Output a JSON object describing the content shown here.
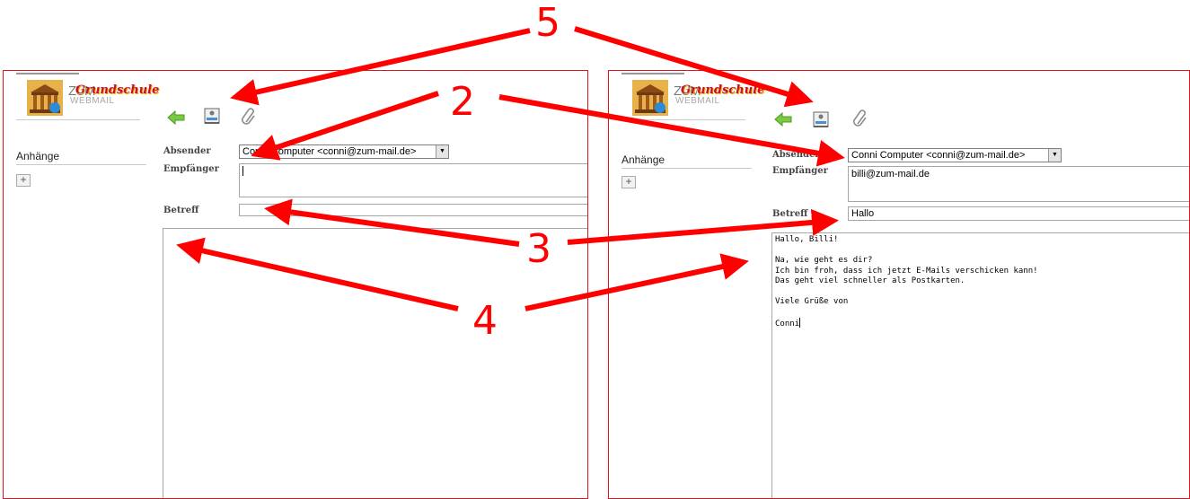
{
  "logo": {
    "zum": "ZUM",
    "grundschule": "Grundschule",
    "webmail": "WEBMAIL"
  },
  "icons": {
    "back": "arrow-left-icon",
    "addressbook": "address-book-icon",
    "attach": "paperclip-icon"
  },
  "sidebar": {
    "attachments_label": "Anhänge",
    "add_label": "+"
  },
  "fields": {
    "sender_label": "Absender",
    "recipient_label": "Empfänger",
    "subject_label": "Betreff"
  },
  "left_form": {
    "sender_value": "Conni Computer <conni@zum-mail.de>",
    "recipient_value": "",
    "subject_value": "",
    "body": ""
  },
  "right_form": {
    "sender_value": "Conni Computer <conni@zum-mail.de>",
    "recipient_value": "billi@zum-mail.de",
    "subject_value": "Hallo",
    "body": "Hallo, Billi!\n\nNa, wie geht es dir?\nIch bin froh, dass ich jetzt E-Mails verschicken kann!\nDas geht viel schneller als Postkarten.\n\nViele Grüße von\n\nConni"
  },
  "annotations": {
    "n2": "2",
    "n3": "3",
    "n4": "4",
    "n5": "5"
  },
  "colors": {
    "annotation": "#ff0000",
    "panel_border": "#e0141c",
    "back_arrow": "#7ac943"
  }
}
